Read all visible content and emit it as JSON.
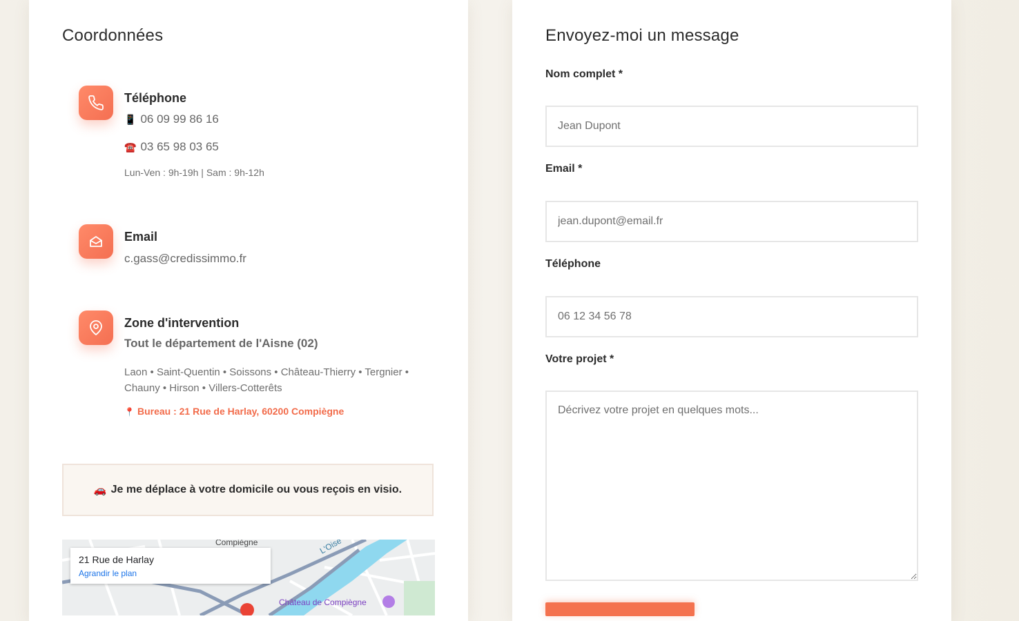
{
  "contact": {
    "heading": "Coordonnées",
    "phone": {
      "title": "Téléphone",
      "mobile_icon": "📱",
      "mobile": "06 09 99 86 16",
      "landline_icon": "☎️",
      "landline": "03 65 98 03 65",
      "hours": "Lun-Ven : 9h-19h | Sam : 9h-12h"
    },
    "email": {
      "title": "Email",
      "address": "c.gass@credissimmo.fr"
    },
    "zone": {
      "title": "Zone d'intervention",
      "subtitle": "Tout le département de l'Aisne (02)",
      "cities": "Laon • Saint-Quentin • Soissons • Château-Thierry • Tergnier • Chauny • Hirson • Villers-Cotterêts",
      "office_icon": "📍",
      "office": "Bureau : 21 Rue de Harlay, 60200 Compiègne"
    },
    "notice_icon": "🚗",
    "notice": "Je me déplace à votre domicile ou vous reçois en visio.",
    "map": {
      "address": "21 Rue de Harlay",
      "enlarge_link": "Agrandir le plan",
      "label_city": "Compiègne",
      "label_chateau": "Château de Compiègne",
      "label_river": "L'Oise"
    }
  },
  "form": {
    "heading": "Envoyez-moi un message",
    "name_label": "Nom complet *",
    "name_placeholder": "Jean Dupont",
    "email_label": "Email *",
    "email_placeholder": "jean.dupont@email.fr",
    "phone_label": "Téléphone",
    "phone_placeholder": "06 12 34 56 78",
    "project_label": "Votre projet *",
    "project_placeholder": "Décrivez votre projet en quelques mots..."
  },
  "colors": {
    "accent": "#f4724f",
    "background": "#f3f0e9",
    "link": "#1a73e8"
  }
}
